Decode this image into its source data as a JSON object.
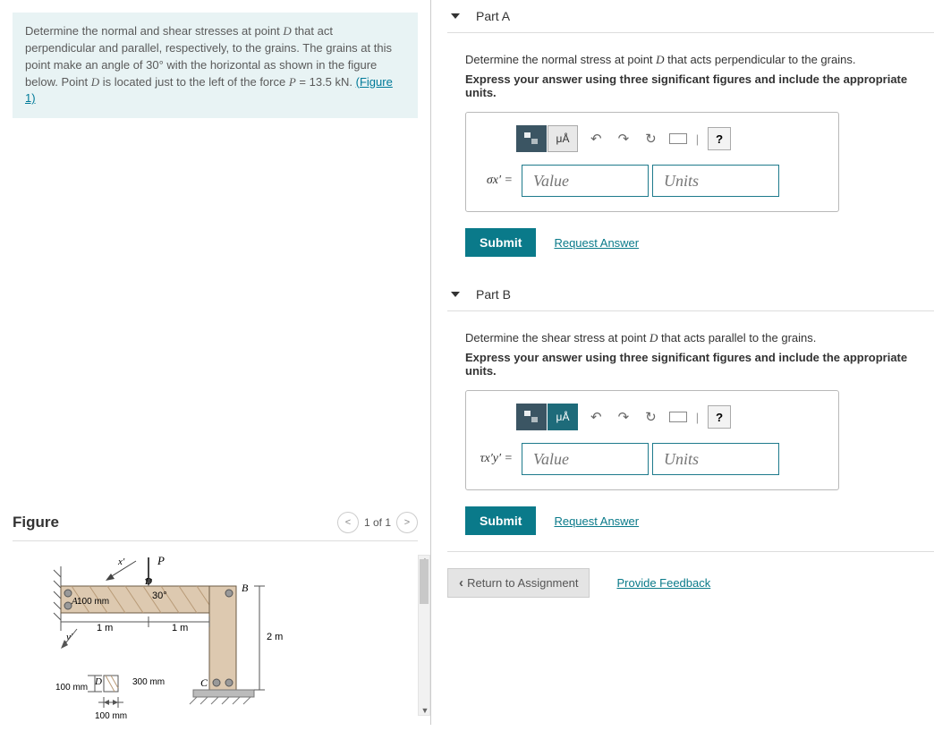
{
  "problem": {
    "text_parts": {
      "l1a": "Determine the normal and shear stresses at point ",
      "l1b": " that act perpendicular and parallel, respectively, to the grains. The grains at this point make an angle of 30° with the horizontal as shown in the figure below. Point ",
      "l1c": " is located just to the left of the force ",
      "l1d": " = 13.5 kN. ",
      "var_D": "D",
      "var_P": "P",
      "figure_link": "(Figure 1)"
    }
  },
  "figure": {
    "title": "Figure",
    "counter": "1 of 1",
    "labels": {
      "P": "P",
      "x_prime": "x′",
      "y_prime": "y′",
      "A": "A",
      "B": "B",
      "C": "C",
      "D": "D",
      "angle": "30°",
      "h1": "100 mm",
      "h2": "100 mm",
      "len1": "1 m",
      "len2": "1 m",
      "drop": "2 m",
      "col_w": "300 mm",
      "base": "100 mm"
    }
  },
  "partA": {
    "label": "Part A",
    "instr1_a": "Determine the normal stress at point ",
    "instr1_b": " that acts perpendicular to the grains.",
    "var_D": "D",
    "instr2": "Express your answer using three significant figures and include the appropriate units.",
    "eq_label": "σx′ =",
    "value_ph": "Value",
    "units_ph": "Units",
    "toolbar": {
      "units": "μÅ",
      "help": "?"
    },
    "submit": "Submit",
    "request": "Request Answer"
  },
  "partB": {
    "label": "Part B",
    "instr1_a": "Determine the shear stress at point ",
    "instr1_b": " that acts parallel to the grains.",
    "var_D": "D",
    "instr2": "Express your answer using three significant figures and include the appropriate units.",
    "eq_label": "τx′y′ =",
    "value_ph": "Value",
    "units_ph": "Units",
    "toolbar": {
      "units": "μÅ",
      "help": "?"
    },
    "submit": "Submit",
    "request": "Request Answer"
  },
  "footer": {
    "return": "Return to Assignment",
    "feedback": "Provide Feedback"
  }
}
